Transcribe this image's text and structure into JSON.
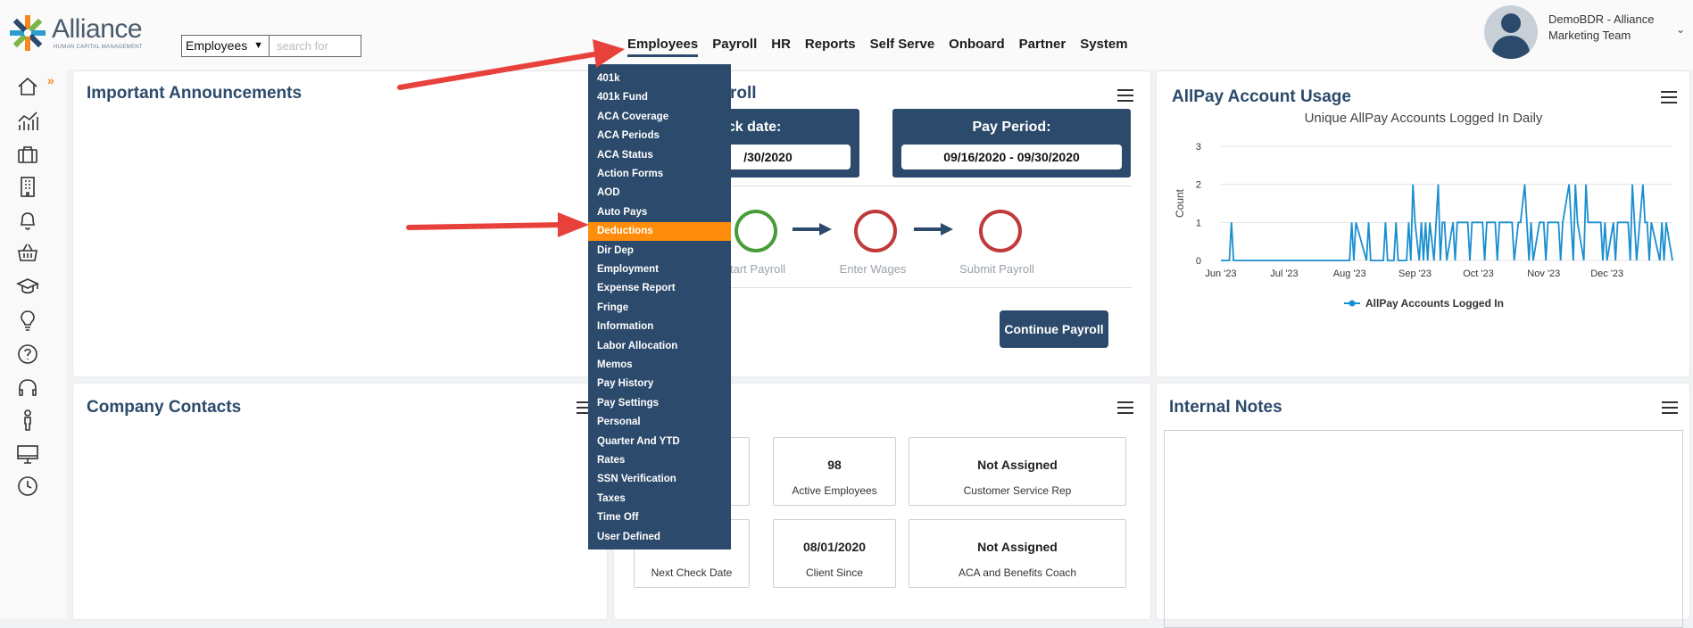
{
  "header": {
    "logo_text": "Alliance",
    "logo_sub": "HUMAN CAPITAL MANAGEMENT",
    "search_select": "Employees",
    "search_placeholder": "search for",
    "nav": [
      "Employees",
      "Payroll",
      "HR",
      "Reports",
      "Self Serve",
      "Onboard",
      "Partner",
      "System"
    ],
    "user_line1": "DemoBDR - Alliance",
    "user_line2": "Marketing Team"
  },
  "sidebar": {
    "icons": [
      "home-icon",
      "analytics-icon",
      "briefcase-icon",
      "building-icon",
      "bell-icon",
      "basket-icon",
      "graduation-cap-icon",
      "lightbulb-icon",
      "help-icon",
      "headset-icon",
      "person-icon",
      "desktop-icon",
      "clock-icon"
    ]
  },
  "announcements": {
    "title": "Important Announcements"
  },
  "payroll": {
    "title_fragment": "roll",
    "check_date_label": "eck date:",
    "check_date_value": "/30/2020",
    "pay_period_label": "Pay Period:",
    "pay_period_value": "09/16/2020 - 09/30/2020",
    "steps": [
      "tart Payroll",
      "Enter Wages",
      "Submit Payroll"
    ],
    "continue_button": "Continue Payroll"
  },
  "usage": {
    "title": "AllPay Account Usage"
  },
  "contacts": {
    "title": "Company Contacts"
  },
  "stats": [
    {
      "value": "98",
      "label": "Active Employees"
    },
    {
      "value": "Not Assigned",
      "label": "Customer Service Rep"
    },
    {
      "value": "",
      "label": "Next Check Date"
    },
    {
      "value": "08/01/2020",
      "label": "Client Since"
    },
    {
      "value": "Not Assigned",
      "label": "ACA and Benefits Coach"
    }
  ],
  "notes": {
    "title": "Internal Notes"
  },
  "dropdown": {
    "items": [
      "401k",
      "401k Fund",
      "ACA Coverage",
      "ACA Periods",
      "ACA Status",
      "Action Forms",
      "AOD",
      "Auto Pays",
      "Deductions",
      "Dir Dep",
      "Employment",
      "Expense Report",
      "Fringe",
      "Information",
      "Labor Allocation",
      "Memos",
      "Pay History",
      "Pay Settings",
      "Personal",
      "Quarter And YTD",
      "Rates",
      "SSN Verification",
      "Taxes",
      "Time Off",
      "User Defined"
    ],
    "selected": "Deductions"
  },
  "colors": {
    "primary": "#2c4a6b",
    "accent": "#ff8c0a",
    "annotation_arrow": "#e8403a",
    "line": "#1a8fd0"
  },
  "chart_data": {
    "type": "line",
    "title": "Unique AllPay Accounts Logged In Daily",
    "ylabel": "Count",
    "xlabel": "",
    "ylim": [
      0,
      3
    ],
    "yticks": [
      0,
      1,
      2,
      3
    ],
    "xticks": [
      "Jun '23",
      "Jul '23",
      "Aug '23",
      "Sep '23",
      "Oct '23",
      "Nov '23",
      "Dec '23"
    ],
    "grid": true,
    "legend": "bottom",
    "series": [
      {
        "name": "AllPay Accounts Logged In",
        "x": [
          "2023-06-01",
          "2023-06-05",
          "2023-06-06",
          "2023-06-07",
          "2023-08-01",
          "2023-08-02",
          "2023-08-03",
          "2023-08-04",
          "2023-08-09",
          "2023-08-10",
          "2023-08-11",
          "2023-08-17",
          "2023-08-18",
          "2023-08-19",
          "2023-08-22",
          "2023-08-23",
          "2023-08-24",
          "2023-08-28",
          "2023-08-29",
          "2023-08-30",
          "2023-08-31",
          "2023-09-01",
          "2023-09-03",
          "2023-09-04",
          "2023-09-05",
          "2023-09-06",
          "2023-09-07",
          "2023-09-08",
          "2023-09-10",
          "2023-09-11",
          "2023-09-12",
          "2023-09-13",
          "2023-09-14",
          "2023-09-15",
          "2023-09-16",
          "2023-09-19",
          "2023-09-20",
          "2023-09-21",
          "2023-09-26",
          "2023-09-27",
          "2023-09-28",
          "2023-10-03",
          "2023-10-04",
          "2023-10-05",
          "2023-10-09",
          "2023-10-10",
          "2023-10-11",
          "2023-10-16",
          "2023-10-17",
          "2023-10-18",
          "2023-10-20",
          "2023-10-21",
          "2023-10-23",
          "2023-10-24",
          "2023-10-25",
          "2023-10-26",
          "2023-10-27",
          "2023-10-30",
          "2023-10-31",
          "2023-11-01",
          "2023-11-02",
          "2023-11-03",
          "2023-11-06",
          "2023-11-07",
          "2023-11-08",
          "2023-11-09",
          "2023-11-10",
          "2023-11-13",
          "2023-11-14",
          "2023-11-15",
          "2023-11-16",
          "2023-11-17",
          "2023-11-20",
          "2023-11-21",
          "2023-11-22",
          "2023-11-27",
          "2023-11-28",
          "2023-11-29",
          "2023-11-30",
          "2023-12-01",
          "2023-12-04",
          "2023-12-05",
          "2023-12-06",
          "2023-12-07",
          "2023-12-08",
          "2023-12-11",
          "2023-12-12",
          "2023-12-13",
          "2023-12-14",
          "2023-12-15",
          "2023-12-18",
          "2023-12-19",
          "2023-12-20",
          "2023-12-21",
          "2023-12-22",
          "2023-12-26",
          "2023-12-27",
          "2023-12-28",
          "2023-12-29",
          "2024-01-01"
        ],
        "y": [
          0,
          0,
          1,
          0,
          0,
          1,
          0,
          1,
          0,
          1,
          0,
          0,
          1,
          0,
          0,
          1,
          0,
          0,
          1,
          0,
          2,
          1,
          0,
          1,
          0,
          1,
          0,
          1,
          0,
          1,
          2,
          0,
          1,
          1,
          0,
          1,
          0,
          1,
          1,
          0,
          1,
          1,
          0,
          1,
          1,
          0,
          1,
          1,
          1,
          0,
          1,
          1,
          2,
          1,
          0,
          1,
          0,
          1,
          1,
          1,
          0,
          1,
          1,
          1,
          1,
          0,
          1,
          2,
          1,
          0,
          2,
          1,
          0,
          2,
          1,
          1,
          1,
          0,
          1,
          0,
          1,
          0,
          1,
          1,
          1,
          1,
          0,
          2,
          1,
          0,
          2,
          1,
          1,
          0,
          1,
          0,
          1,
          0,
          1,
          0
        ]
      }
    ]
  }
}
